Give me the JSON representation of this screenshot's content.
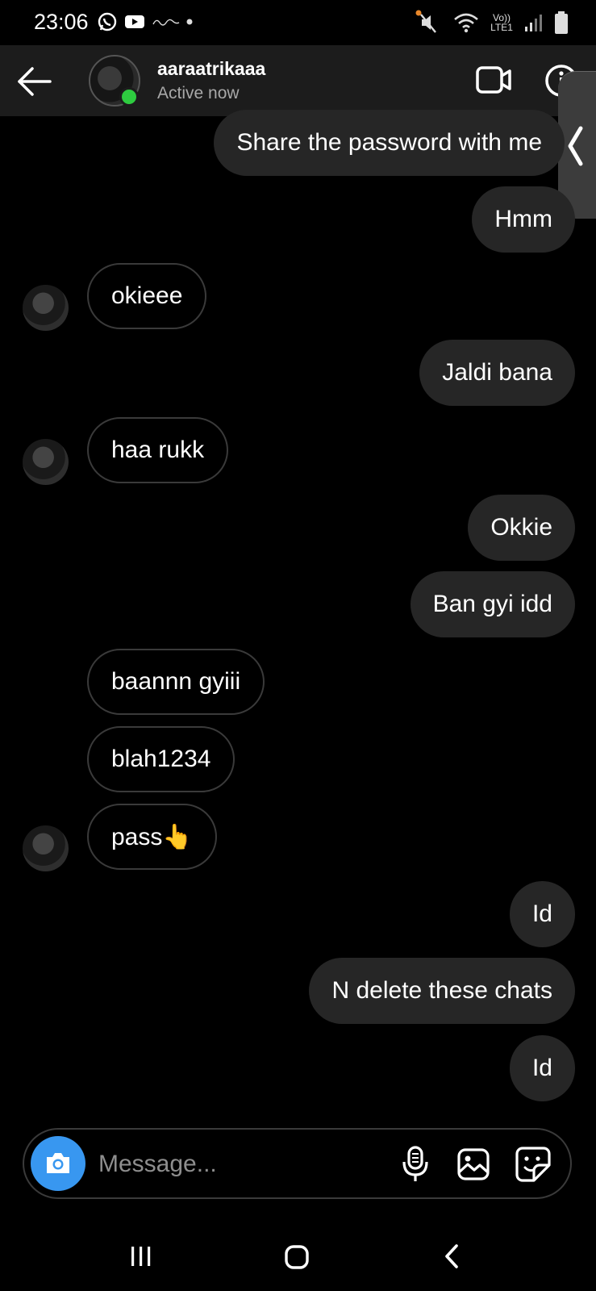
{
  "status_bar": {
    "time": "23:06",
    "network_label": "Vo)) LTE1",
    "icons": [
      "whatsapp-icon",
      "youtube-icon",
      "scribbl-icon",
      "mute-icon",
      "wifi-icon",
      "signal-icon",
      "battery-icon"
    ]
  },
  "header": {
    "username": "aaraatrikaaa",
    "status": "Active now",
    "online_color": "#2ecc40"
  },
  "messages": [
    {
      "side": "out",
      "text": "Share the password with me"
    },
    {
      "side": "out",
      "text": "Hmm"
    },
    {
      "side": "in",
      "text": "okieee",
      "avatar": true
    },
    {
      "side": "out",
      "text": "Jaldi bana"
    },
    {
      "side": "in",
      "text": "haa rukk",
      "avatar": true
    },
    {
      "side": "out",
      "text": "Okkie"
    },
    {
      "side": "out",
      "text": "Ban gyi idd"
    },
    {
      "side": "in",
      "text": "baannn gyiii",
      "avatar": false
    },
    {
      "side": "in",
      "text": "blah1234",
      "avatar": false
    },
    {
      "side": "in",
      "text": "pass👆",
      "avatar": true
    },
    {
      "side": "out",
      "text": "Id"
    },
    {
      "side": "out",
      "text": "N delete these chats"
    },
    {
      "side": "out",
      "text": "Id"
    }
  ],
  "composer": {
    "placeholder": "Message...",
    "value": "",
    "accent": "#3897f0"
  },
  "colors": {
    "background": "#000000",
    "outgoing_bubble": "#262626",
    "header": "#1c1c1c"
  }
}
